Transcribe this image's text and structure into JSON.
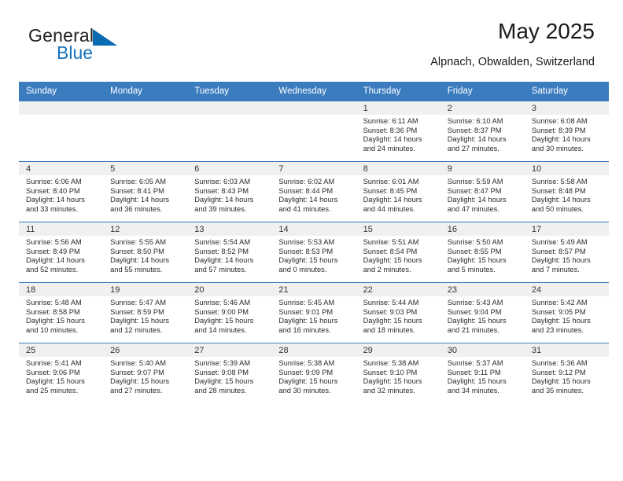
{
  "brand": {
    "word1": "General",
    "word2": "Blue",
    "triangle_color": "#0a6bb3",
    "blue_text_color": "#1673bd"
  },
  "header": {
    "title": "May 2025",
    "location": "Alpnach, Obwalden, Switzerland"
  },
  "theme": {
    "header_row_bg": "#3b7cbf",
    "day_band_bg": "#f0f0f0",
    "grid_line": "#3b7cbf"
  },
  "weekday_headers": [
    "Sunday",
    "Monday",
    "Tuesday",
    "Wednesday",
    "Thursday",
    "Friday",
    "Saturday"
  ],
  "labels": {
    "sunrise_prefix": "Sunrise:",
    "sunset_prefix": "Sunset:",
    "daylight_prefix": "Daylight:"
  },
  "weeks": [
    [
      {
        "day": "",
        "empty": true,
        "l1": "",
        "l2": "",
        "l3": "",
        "l4": ""
      },
      {
        "day": "",
        "empty": true,
        "l1": "",
        "l2": "",
        "l3": "",
        "l4": ""
      },
      {
        "day": "",
        "empty": true,
        "l1": "",
        "l2": "",
        "l3": "",
        "l4": ""
      },
      {
        "day": "",
        "empty": true,
        "l1": "",
        "l2": "",
        "l3": "",
        "l4": ""
      },
      {
        "day": "1",
        "empty": false,
        "l1": "Sunrise: 6:11 AM",
        "l2": "Sunset: 8:36 PM",
        "l3": "Daylight: 14 hours",
        "l4": "and 24 minutes."
      },
      {
        "day": "2",
        "empty": false,
        "l1": "Sunrise: 6:10 AM",
        "l2": "Sunset: 8:37 PM",
        "l3": "Daylight: 14 hours",
        "l4": "and 27 minutes."
      },
      {
        "day": "3",
        "empty": false,
        "l1": "Sunrise: 6:08 AM",
        "l2": "Sunset: 8:39 PM",
        "l3": "Daylight: 14 hours",
        "l4": "and 30 minutes."
      }
    ],
    [
      {
        "day": "4",
        "empty": false,
        "l1": "Sunrise: 6:06 AM",
        "l2": "Sunset: 8:40 PM",
        "l3": "Daylight: 14 hours",
        "l4": "and 33 minutes."
      },
      {
        "day": "5",
        "empty": false,
        "l1": "Sunrise: 6:05 AM",
        "l2": "Sunset: 8:41 PM",
        "l3": "Daylight: 14 hours",
        "l4": "and 36 minutes."
      },
      {
        "day": "6",
        "empty": false,
        "l1": "Sunrise: 6:03 AM",
        "l2": "Sunset: 8:43 PM",
        "l3": "Daylight: 14 hours",
        "l4": "and 39 minutes."
      },
      {
        "day": "7",
        "empty": false,
        "l1": "Sunrise: 6:02 AM",
        "l2": "Sunset: 8:44 PM",
        "l3": "Daylight: 14 hours",
        "l4": "and 41 minutes."
      },
      {
        "day": "8",
        "empty": false,
        "l1": "Sunrise: 6:01 AM",
        "l2": "Sunset: 8:45 PM",
        "l3": "Daylight: 14 hours",
        "l4": "and 44 minutes."
      },
      {
        "day": "9",
        "empty": false,
        "l1": "Sunrise: 5:59 AM",
        "l2": "Sunset: 8:47 PM",
        "l3": "Daylight: 14 hours",
        "l4": "and 47 minutes."
      },
      {
        "day": "10",
        "empty": false,
        "l1": "Sunrise: 5:58 AM",
        "l2": "Sunset: 8:48 PM",
        "l3": "Daylight: 14 hours",
        "l4": "and 50 minutes."
      }
    ],
    [
      {
        "day": "11",
        "empty": false,
        "l1": "Sunrise: 5:56 AM",
        "l2": "Sunset: 8:49 PM",
        "l3": "Daylight: 14 hours",
        "l4": "and 52 minutes."
      },
      {
        "day": "12",
        "empty": false,
        "l1": "Sunrise: 5:55 AM",
        "l2": "Sunset: 8:50 PM",
        "l3": "Daylight: 14 hours",
        "l4": "and 55 minutes."
      },
      {
        "day": "13",
        "empty": false,
        "l1": "Sunrise: 5:54 AM",
        "l2": "Sunset: 8:52 PM",
        "l3": "Daylight: 14 hours",
        "l4": "and 57 minutes."
      },
      {
        "day": "14",
        "empty": false,
        "l1": "Sunrise: 5:53 AM",
        "l2": "Sunset: 8:53 PM",
        "l3": "Daylight: 15 hours",
        "l4": "and 0 minutes."
      },
      {
        "day": "15",
        "empty": false,
        "l1": "Sunrise: 5:51 AM",
        "l2": "Sunset: 8:54 PM",
        "l3": "Daylight: 15 hours",
        "l4": "and 2 minutes."
      },
      {
        "day": "16",
        "empty": false,
        "l1": "Sunrise: 5:50 AM",
        "l2": "Sunset: 8:55 PM",
        "l3": "Daylight: 15 hours",
        "l4": "and 5 minutes."
      },
      {
        "day": "17",
        "empty": false,
        "l1": "Sunrise: 5:49 AM",
        "l2": "Sunset: 8:57 PM",
        "l3": "Daylight: 15 hours",
        "l4": "and 7 minutes."
      }
    ],
    [
      {
        "day": "18",
        "empty": false,
        "l1": "Sunrise: 5:48 AM",
        "l2": "Sunset: 8:58 PM",
        "l3": "Daylight: 15 hours",
        "l4": "and 10 minutes."
      },
      {
        "day": "19",
        "empty": false,
        "l1": "Sunrise: 5:47 AM",
        "l2": "Sunset: 8:59 PM",
        "l3": "Daylight: 15 hours",
        "l4": "and 12 minutes."
      },
      {
        "day": "20",
        "empty": false,
        "l1": "Sunrise: 5:46 AM",
        "l2": "Sunset: 9:00 PM",
        "l3": "Daylight: 15 hours",
        "l4": "and 14 minutes."
      },
      {
        "day": "21",
        "empty": false,
        "l1": "Sunrise: 5:45 AM",
        "l2": "Sunset: 9:01 PM",
        "l3": "Daylight: 15 hours",
        "l4": "and 16 minutes."
      },
      {
        "day": "22",
        "empty": false,
        "l1": "Sunrise: 5:44 AM",
        "l2": "Sunset: 9:03 PM",
        "l3": "Daylight: 15 hours",
        "l4": "and 18 minutes."
      },
      {
        "day": "23",
        "empty": false,
        "l1": "Sunrise: 5:43 AM",
        "l2": "Sunset: 9:04 PM",
        "l3": "Daylight: 15 hours",
        "l4": "and 21 minutes."
      },
      {
        "day": "24",
        "empty": false,
        "l1": "Sunrise: 5:42 AM",
        "l2": "Sunset: 9:05 PM",
        "l3": "Daylight: 15 hours",
        "l4": "and 23 minutes."
      }
    ],
    [
      {
        "day": "25",
        "empty": false,
        "l1": "Sunrise: 5:41 AM",
        "l2": "Sunset: 9:06 PM",
        "l3": "Daylight: 15 hours",
        "l4": "and 25 minutes."
      },
      {
        "day": "26",
        "empty": false,
        "l1": "Sunrise: 5:40 AM",
        "l2": "Sunset: 9:07 PM",
        "l3": "Daylight: 15 hours",
        "l4": "and 27 minutes."
      },
      {
        "day": "27",
        "empty": false,
        "l1": "Sunrise: 5:39 AM",
        "l2": "Sunset: 9:08 PM",
        "l3": "Daylight: 15 hours",
        "l4": "and 28 minutes."
      },
      {
        "day": "28",
        "empty": false,
        "l1": "Sunrise: 5:38 AM",
        "l2": "Sunset: 9:09 PM",
        "l3": "Daylight: 15 hours",
        "l4": "and 30 minutes."
      },
      {
        "day": "29",
        "empty": false,
        "l1": "Sunrise: 5:38 AM",
        "l2": "Sunset: 9:10 PM",
        "l3": "Daylight: 15 hours",
        "l4": "and 32 minutes."
      },
      {
        "day": "30",
        "empty": false,
        "l1": "Sunrise: 5:37 AM",
        "l2": "Sunset: 9:11 PM",
        "l3": "Daylight: 15 hours",
        "l4": "and 34 minutes."
      },
      {
        "day": "31",
        "empty": false,
        "l1": "Sunrise: 5:36 AM",
        "l2": "Sunset: 9:12 PM",
        "l3": "Daylight: 15 hours",
        "l4": "and 35 minutes."
      }
    ]
  ]
}
